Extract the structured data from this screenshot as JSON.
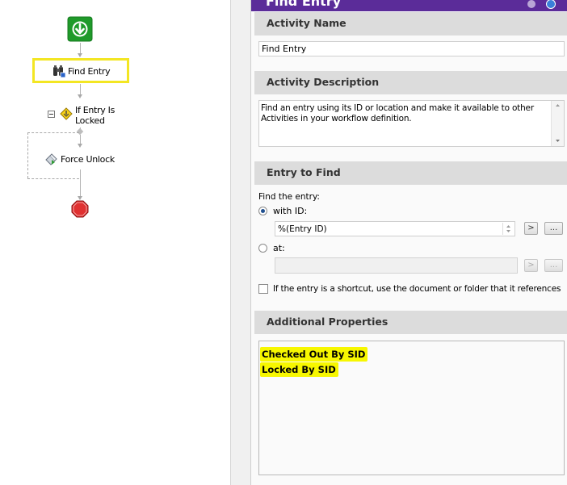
{
  "workflow": {
    "nodes": {
      "find_entry": "Find Entry",
      "if_entry_locked": [
        "If Entry Is",
        "Locked"
      ],
      "force_unlock": "Force Unlock"
    },
    "collapse_glyph": "⊟"
  },
  "panel": {
    "title": "Find Entry",
    "sections": {
      "activity_name": {
        "heading": "Activity Name",
        "value": "Find Entry"
      },
      "activity_description": {
        "heading": "Activity Description",
        "value": "Find an entry using its ID or location and make it available to other Activities in your workflow definition."
      },
      "entry_to_find": {
        "heading": "Entry to Find",
        "prompt": "Find the entry:",
        "with_id_label": "with ID:",
        "with_id_value": "%(Entry ID)",
        "with_id_checked": true,
        "at_label": "at:",
        "at_value": "",
        "at_checked": false,
        "arrow_button": ">",
        "ellipsis_button": "...",
        "shortcut_label": "If the entry is a shortcut, use the document or folder that it references",
        "shortcut_checked": false
      },
      "additional_properties": {
        "heading": "Additional Properties",
        "items": [
          "Checked Out By SID",
          "Locked By SID"
        ]
      }
    }
  },
  "colors": {
    "title_bar": "#5b2c99",
    "start_node": "#22a02c",
    "highlight": "#f7f700",
    "selection_border": "#f3e623",
    "section_header": "#dcdcdc",
    "stop_node": "#e03030"
  }
}
